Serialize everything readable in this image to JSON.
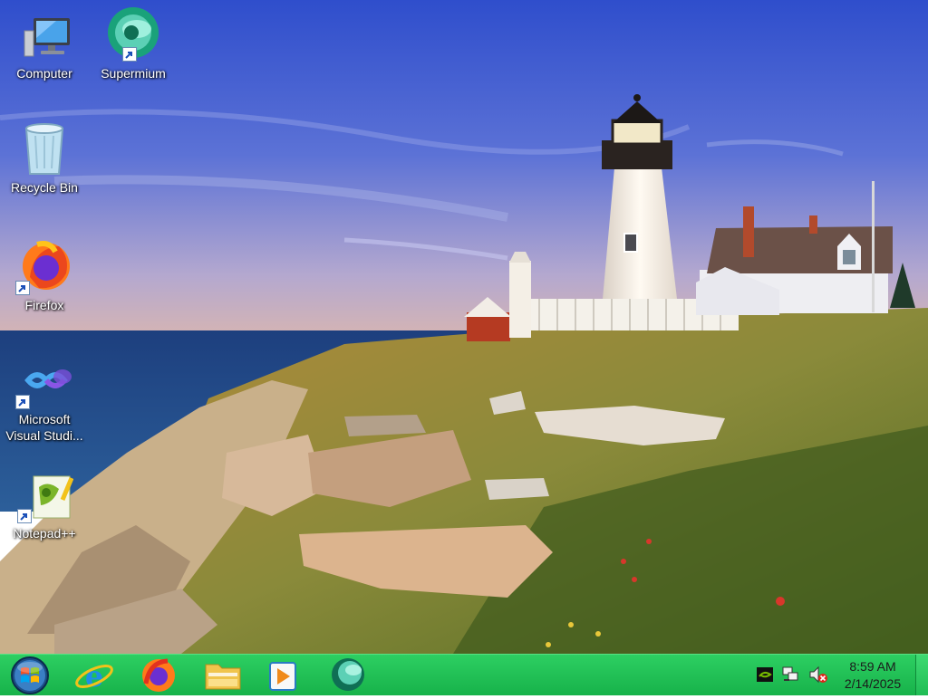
{
  "desktop": {
    "icons": [
      {
        "label": "Computer"
      },
      {
        "label": "Supermium"
      },
      {
        "label": "Recycle Bin"
      },
      {
        "label": "Firefox"
      },
      {
        "label": "Microsoft\nVisual Studi..."
      },
      {
        "label": "Notepad++"
      }
    ]
  },
  "taskbar": {
    "color": "#1fc054",
    "pinned": [
      "start-orb",
      "internet-explorer",
      "firefox",
      "file-explorer",
      "media-player",
      "supermium"
    ],
    "tray": [
      "nvidia-icon",
      "network-icon",
      "volume-muted-icon"
    ],
    "clock": {
      "time": "8:59 AM",
      "date": "2/14/2025"
    }
  }
}
